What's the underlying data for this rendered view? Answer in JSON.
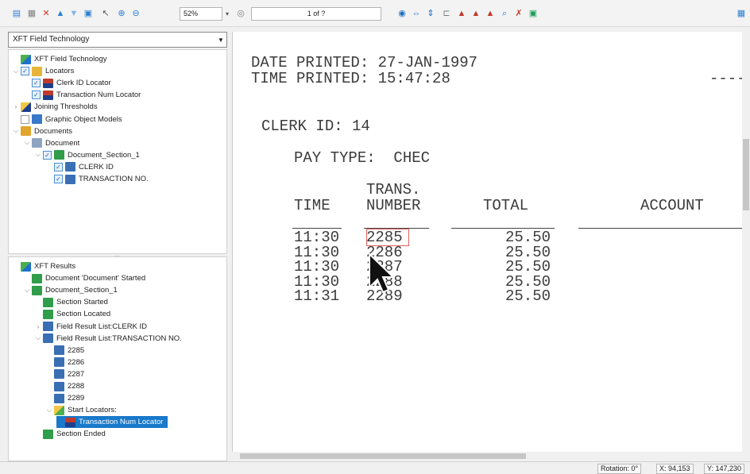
{
  "toolbar": {
    "zoom": "52%",
    "page_indicator": "1 of ?"
  },
  "document_selector": {
    "value": "XFT Field Technology"
  },
  "definition_tree": [
    {
      "label": "XFT Field Technology",
      "icon": "field-tech-icon",
      "depth": 0,
      "expander": "",
      "checkbox": "none"
    },
    {
      "label": "Locators",
      "icon": "locators-folder-icon",
      "depth": 0,
      "expander": "v",
      "checkbox": "checked"
    },
    {
      "label": "Clerk ID Locator",
      "icon": "locator-icon",
      "depth": 1,
      "expander": "",
      "checkbox": "checked"
    },
    {
      "label": "Transaction Num Locator",
      "icon": "locator-icon",
      "depth": 1,
      "expander": "",
      "checkbox": "checked"
    },
    {
      "label": "Joining Thresholds",
      "icon": "threshold-icon",
      "depth": 0,
      "expander": ">",
      "checkbox": "none"
    },
    {
      "label": "Graphic Object Models",
      "icon": "graphic-model-icon",
      "depth": 0,
      "expander": "",
      "checkbox": "empty"
    },
    {
      "label": "Documents",
      "icon": "documents-icon",
      "depth": 0,
      "expander": "v",
      "checkbox": "none"
    },
    {
      "label": "Document",
      "icon": "document-icon",
      "depth": 1,
      "expander": "v",
      "checkbox": "none"
    },
    {
      "label": "Document_Section_1",
      "icon": "section-icon",
      "depth": 2,
      "expander": "v",
      "checkbox": "checked"
    },
    {
      "label": "CLERK ID",
      "icon": "field-icon",
      "depth": 3,
      "expander": "",
      "checkbox": "checked"
    },
    {
      "label": "TRANSACTION NO.",
      "icon": "field-icon",
      "depth": 3,
      "expander": "",
      "checkbox": "checked"
    }
  ],
  "results_tree": [
    {
      "label": "XFT Results",
      "icon": "results-icon",
      "depth": 0,
      "expander": "",
      "selected": false
    },
    {
      "label": "Document 'Document' Started",
      "icon": "event-icon",
      "depth": 1,
      "expander": "",
      "selected": false
    },
    {
      "label": "Document_Section_1",
      "icon": "section-icon",
      "depth": 1,
      "expander": "v",
      "selected": false
    },
    {
      "label": "Section Started",
      "icon": "event-icon",
      "depth": 2,
      "expander": "",
      "selected": false
    },
    {
      "label": "Section Located",
      "icon": "event-icon",
      "depth": 2,
      "expander": "",
      "selected": false
    },
    {
      "label": "Field Result List:CLERK ID",
      "icon": "field-icon",
      "depth": 2,
      "expander": ">",
      "selected": false
    },
    {
      "label": "Field Result List:TRANSACTION NO.",
      "icon": "field-icon",
      "depth": 2,
      "expander": "v",
      "selected": false
    },
    {
      "label": "2285",
      "icon": "field-icon",
      "depth": 3,
      "expander": "",
      "selected": false
    },
    {
      "label": "2286",
      "icon": "field-icon",
      "depth": 3,
      "expander": "",
      "selected": false
    },
    {
      "label": "2287",
      "icon": "field-icon",
      "depth": 3,
      "expander": "",
      "selected": false
    },
    {
      "label": "2288",
      "icon": "field-icon",
      "depth": 3,
      "expander": "",
      "selected": false
    },
    {
      "label": "2289",
      "icon": "field-icon",
      "depth": 3,
      "expander": "",
      "selected": false
    },
    {
      "label": "Start Locators:",
      "icon": "locators-icon",
      "depth": 3,
      "expander": "v",
      "selected": false
    },
    {
      "label": "Transaction Num Locator",
      "icon": "locator-icon",
      "depth": 4,
      "expander": "",
      "selected": true
    },
    {
      "label": "Section Ended",
      "icon": "event-icon",
      "depth": 2,
      "expander": "",
      "selected": false
    }
  ],
  "document": {
    "date_line": "DATE PRINTED: 27-JAN-1997",
    "time_line": "TIME PRINTED: 15:47:28",
    "dashes": "----",
    "clerk_line": "CLERK ID: 14",
    "pay_type_line": "PAY TYPE:  CHEC",
    "col_time": "TIME",
    "col_trans_1": "TRANS.",
    "col_trans_2": "NUMBER",
    "col_total": "TOTAL",
    "col_account": "ACCOUNT",
    "rows": [
      {
        "time": "11:30",
        "number": "2285",
        "total": "25.50"
      },
      {
        "time": "11:30",
        "number": "2286",
        "total": "25.50"
      },
      {
        "time": "11:30",
        "number": "2287",
        "total": "25.50"
      },
      {
        "time": "11:30",
        "number": "2288",
        "total": "25.50"
      },
      {
        "time": "11:31",
        "number": "2289",
        "total": "25.50"
      }
    ]
  },
  "status": {
    "rotation": "Rotation: 0°",
    "x": "X: 94,153",
    "y": "Y: 147,230"
  },
  "colors": {
    "selection": "#1979ca",
    "highlight_box": "#e0635e"
  }
}
